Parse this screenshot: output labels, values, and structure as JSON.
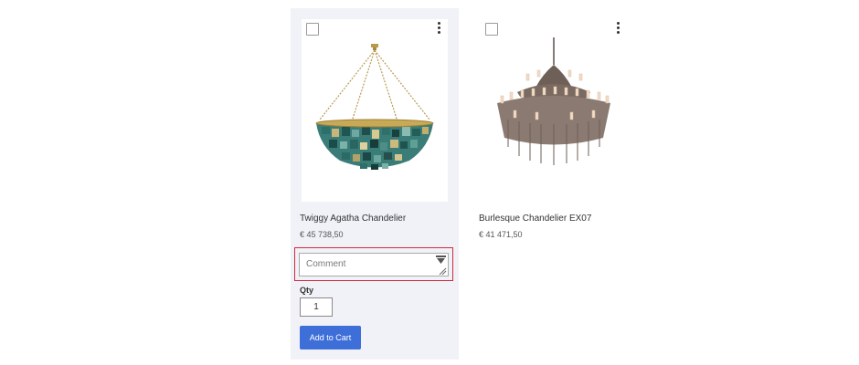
{
  "products": [
    {
      "name": "Twiggy Agatha Chandelier",
      "price": "€ 45 738,50",
      "image_icon": "chandelier-bowl-icon",
      "comment_placeholder": "Comment",
      "qty_label": "Qty",
      "qty_value": "1",
      "add_to_cart_label": "Add to Cart",
      "selected": false
    },
    {
      "name": "Burlesque Chandelier EX07",
      "price": "€ 41 471,50",
      "image_icon": "chandelier-tiered-icon",
      "selected": false
    }
  ],
  "colors": {
    "card_background": "#f1f2f8",
    "button": "#3e6fd8",
    "highlight_border": "#d02b3a"
  }
}
